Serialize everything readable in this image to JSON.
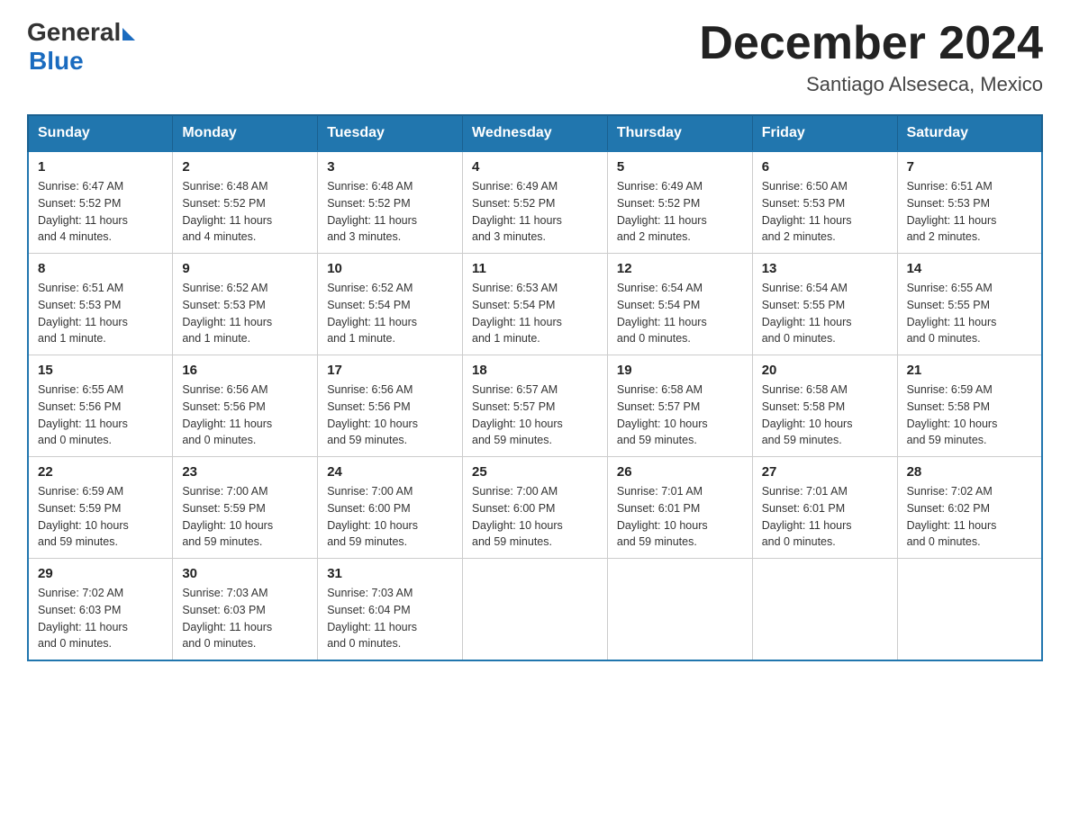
{
  "header": {
    "logo_general": "General",
    "logo_blue": "Blue",
    "title": "December 2024",
    "location": "Santiago Alseseca, Mexico"
  },
  "days_of_week": [
    "Sunday",
    "Monday",
    "Tuesday",
    "Wednesday",
    "Thursday",
    "Friday",
    "Saturday"
  ],
  "weeks": [
    [
      {
        "num": "1",
        "sunrise": "6:47 AM",
        "sunset": "5:52 PM",
        "daylight": "11 hours and 4 minutes."
      },
      {
        "num": "2",
        "sunrise": "6:48 AM",
        "sunset": "5:52 PM",
        "daylight": "11 hours and 4 minutes."
      },
      {
        "num": "3",
        "sunrise": "6:48 AM",
        "sunset": "5:52 PM",
        "daylight": "11 hours and 3 minutes."
      },
      {
        "num": "4",
        "sunrise": "6:49 AM",
        "sunset": "5:52 PM",
        "daylight": "11 hours and 3 minutes."
      },
      {
        "num": "5",
        "sunrise": "6:49 AM",
        "sunset": "5:52 PM",
        "daylight": "11 hours and 2 minutes."
      },
      {
        "num": "6",
        "sunrise": "6:50 AM",
        "sunset": "5:53 PM",
        "daylight": "11 hours and 2 minutes."
      },
      {
        "num": "7",
        "sunrise": "6:51 AM",
        "sunset": "5:53 PM",
        "daylight": "11 hours and 2 minutes."
      }
    ],
    [
      {
        "num": "8",
        "sunrise": "6:51 AM",
        "sunset": "5:53 PM",
        "daylight": "11 hours and 1 minute."
      },
      {
        "num": "9",
        "sunrise": "6:52 AM",
        "sunset": "5:53 PM",
        "daylight": "11 hours and 1 minute."
      },
      {
        "num": "10",
        "sunrise": "6:52 AM",
        "sunset": "5:54 PM",
        "daylight": "11 hours and 1 minute."
      },
      {
        "num": "11",
        "sunrise": "6:53 AM",
        "sunset": "5:54 PM",
        "daylight": "11 hours and 1 minute."
      },
      {
        "num": "12",
        "sunrise": "6:54 AM",
        "sunset": "5:54 PM",
        "daylight": "11 hours and 0 minutes."
      },
      {
        "num": "13",
        "sunrise": "6:54 AM",
        "sunset": "5:55 PM",
        "daylight": "11 hours and 0 minutes."
      },
      {
        "num": "14",
        "sunrise": "6:55 AM",
        "sunset": "5:55 PM",
        "daylight": "11 hours and 0 minutes."
      }
    ],
    [
      {
        "num": "15",
        "sunrise": "6:55 AM",
        "sunset": "5:56 PM",
        "daylight": "11 hours and 0 minutes."
      },
      {
        "num": "16",
        "sunrise": "6:56 AM",
        "sunset": "5:56 PM",
        "daylight": "11 hours and 0 minutes."
      },
      {
        "num": "17",
        "sunrise": "6:56 AM",
        "sunset": "5:56 PM",
        "daylight": "10 hours and 59 minutes."
      },
      {
        "num": "18",
        "sunrise": "6:57 AM",
        "sunset": "5:57 PM",
        "daylight": "10 hours and 59 minutes."
      },
      {
        "num": "19",
        "sunrise": "6:58 AM",
        "sunset": "5:57 PM",
        "daylight": "10 hours and 59 minutes."
      },
      {
        "num": "20",
        "sunrise": "6:58 AM",
        "sunset": "5:58 PM",
        "daylight": "10 hours and 59 minutes."
      },
      {
        "num": "21",
        "sunrise": "6:59 AM",
        "sunset": "5:58 PM",
        "daylight": "10 hours and 59 minutes."
      }
    ],
    [
      {
        "num": "22",
        "sunrise": "6:59 AM",
        "sunset": "5:59 PM",
        "daylight": "10 hours and 59 minutes."
      },
      {
        "num": "23",
        "sunrise": "7:00 AM",
        "sunset": "5:59 PM",
        "daylight": "10 hours and 59 minutes."
      },
      {
        "num": "24",
        "sunrise": "7:00 AM",
        "sunset": "6:00 PM",
        "daylight": "10 hours and 59 minutes."
      },
      {
        "num": "25",
        "sunrise": "7:00 AM",
        "sunset": "6:00 PM",
        "daylight": "10 hours and 59 minutes."
      },
      {
        "num": "26",
        "sunrise": "7:01 AM",
        "sunset": "6:01 PM",
        "daylight": "10 hours and 59 minutes."
      },
      {
        "num": "27",
        "sunrise": "7:01 AM",
        "sunset": "6:01 PM",
        "daylight": "11 hours and 0 minutes."
      },
      {
        "num": "28",
        "sunrise": "7:02 AM",
        "sunset": "6:02 PM",
        "daylight": "11 hours and 0 minutes."
      }
    ],
    [
      {
        "num": "29",
        "sunrise": "7:02 AM",
        "sunset": "6:03 PM",
        "daylight": "11 hours and 0 minutes."
      },
      {
        "num": "30",
        "sunrise": "7:03 AM",
        "sunset": "6:03 PM",
        "daylight": "11 hours and 0 minutes."
      },
      {
        "num": "31",
        "sunrise": "7:03 AM",
        "sunset": "6:04 PM",
        "daylight": "11 hours and 0 minutes."
      },
      null,
      null,
      null,
      null
    ]
  ],
  "labels": {
    "sunrise": "Sunrise:",
    "sunset": "Sunset:",
    "daylight": "Daylight:"
  }
}
